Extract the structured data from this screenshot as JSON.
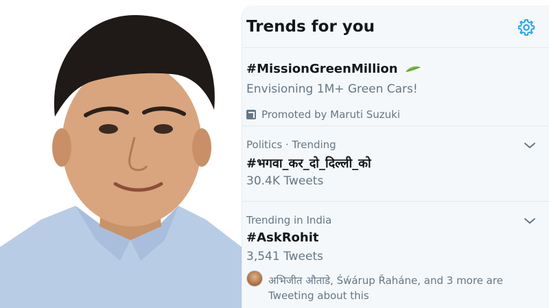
{
  "panel": {
    "title": "Trends for you",
    "settings_icon": "gear-icon",
    "accent_color": "#1da1f2"
  },
  "trends": [
    {
      "hashtag": "#MissionGreenMillion",
      "description": "Envisioning 1M+ Green Cars!",
      "promoted_text": "Promoted by Maruti Suzuki",
      "icon": "leaf-icon"
    },
    {
      "context": "Politics · Trending",
      "hashtag": "#भगवा_कर_दो_दिल्ली_को",
      "count": "30.4K Tweets"
    },
    {
      "context": "Trending in India",
      "hashtag": "#AskRohit",
      "count": "3,541 Tweets",
      "social_line1": "अभिजीत औताडे, Śẃárup Řaháne, and 3 more are",
      "social_line2": "Tweeting about this"
    }
  ]
}
